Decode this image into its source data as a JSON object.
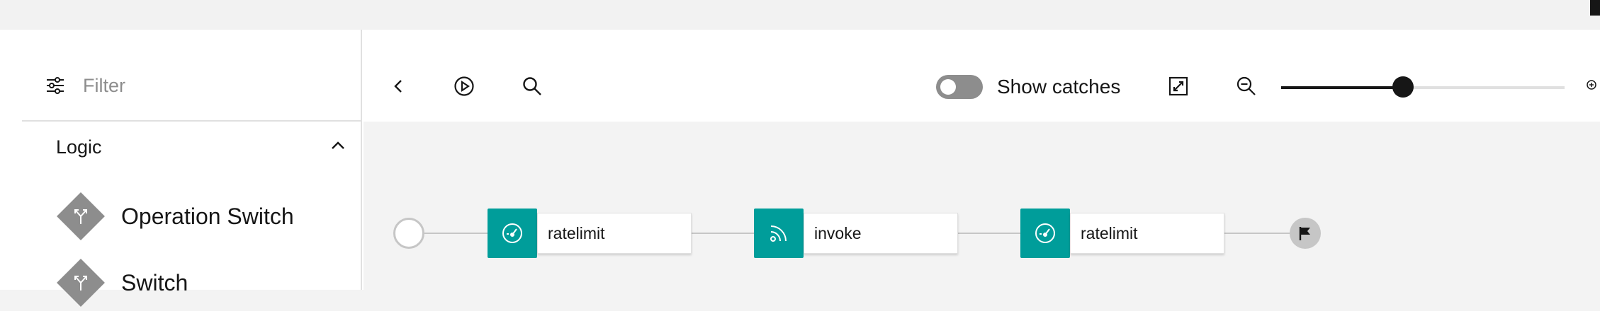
{
  "filter": {
    "placeholder": "Filter"
  },
  "palette": {
    "category": "Logic",
    "items": [
      {
        "label": "Operation Switch",
        "icon": "branch-icon"
      },
      {
        "label": "Switch",
        "icon": "branch-icon"
      }
    ]
  },
  "toolbar": {
    "show_catches_label": "Show catches",
    "show_catches_on": false,
    "zoom_level_fraction": 0.43
  },
  "assembly": {
    "nodes": [
      {
        "label": "ratelimit",
        "icon": "dashboard-gauge-icon"
      },
      {
        "label": "invoke",
        "icon": "signal-invoke-icon"
      },
      {
        "label": "ratelimit",
        "icon": "dashboard-gauge-icon"
      }
    ]
  },
  "colors": {
    "node_accent": "#009d9a",
    "connector": "#c6c6c6",
    "diamond": "#8d8d8d"
  }
}
